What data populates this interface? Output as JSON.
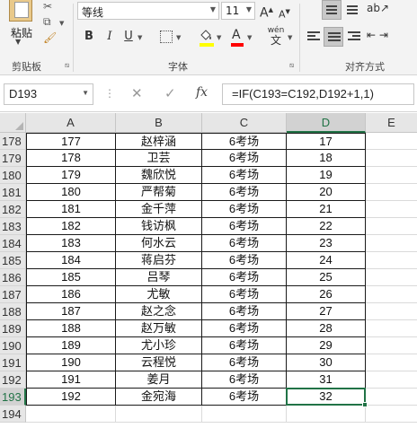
{
  "ribbon": {
    "clipboard": {
      "paste_label": "粘贴",
      "group_label": "剪贴板"
    },
    "font": {
      "font_name": "等线",
      "font_size": "11",
      "group_label": "字体",
      "bold": "B",
      "italic": "I",
      "underline": "U",
      "grow": "A",
      "shrink": "A",
      "font_color": "A",
      "phonetic_top": "wén",
      "phonetic_bottom": "文"
    },
    "alignment": {
      "group_label": "对齐方式"
    },
    "partial_right": "≡ ↓ ┼"
  },
  "formula_bar": {
    "name_box": "D193",
    "fx": "fx",
    "formula": "=IF(C193=C192,D192+1,1)",
    "cancel": "✕",
    "enter": "✓"
  },
  "grid": {
    "columns": [
      "A",
      "B",
      "C",
      "D",
      "E"
    ],
    "selected_column": "D",
    "selected_row": "193",
    "rows": [
      {
        "num": "178",
        "a": "177",
        "b": "赵梓涵",
        "c": "6考场",
        "d": "17"
      },
      {
        "num": "179",
        "a": "178",
        "b": "卫芸",
        "c": "6考场",
        "d": "18"
      },
      {
        "num": "180",
        "a": "179",
        "b": "魏欣悦",
        "c": "6考场",
        "d": "19"
      },
      {
        "num": "181",
        "a": "180",
        "b": "严帮菊",
        "c": "6考场",
        "d": "20"
      },
      {
        "num": "182",
        "a": "181",
        "b": "金千萍",
        "c": "6考场",
        "d": "21"
      },
      {
        "num": "183",
        "a": "182",
        "b": "钱访枫",
        "c": "6考场",
        "d": "22"
      },
      {
        "num": "184",
        "a": "183",
        "b": "何水云",
        "c": "6考场",
        "d": "23"
      },
      {
        "num": "185",
        "a": "184",
        "b": "蒋启芬",
        "c": "6考场",
        "d": "24"
      },
      {
        "num": "186",
        "a": "185",
        "b": "吕琴",
        "c": "6考场",
        "d": "25"
      },
      {
        "num": "187",
        "a": "186",
        "b": "尤敏",
        "c": "6考场",
        "d": "26"
      },
      {
        "num": "188",
        "a": "187",
        "b": "赵之念",
        "c": "6考场",
        "d": "27"
      },
      {
        "num": "189",
        "a": "188",
        "b": "赵万敏",
        "c": "6考场",
        "d": "28"
      },
      {
        "num": "190",
        "a": "189",
        "b": "尤小珍",
        "c": "6考场",
        "d": "29"
      },
      {
        "num": "191",
        "a": "190",
        "b": "云程悦",
        "c": "6考场",
        "d": "30"
      },
      {
        "num": "192",
        "a": "191",
        "b": "姜月",
        "c": "6考场",
        "d": "31"
      },
      {
        "num": "193",
        "a": "192",
        "b": "金宛海",
        "c": "6考场",
        "d": "32"
      },
      {
        "num": "194",
        "a": "",
        "b": "",
        "c": "",
        "d": ""
      }
    ]
  },
  "colors": {
    "excel_green": "#217346",
    "highlight_yellow": "#ffff00",
    "font_red": "#ff0000"
  }
}
